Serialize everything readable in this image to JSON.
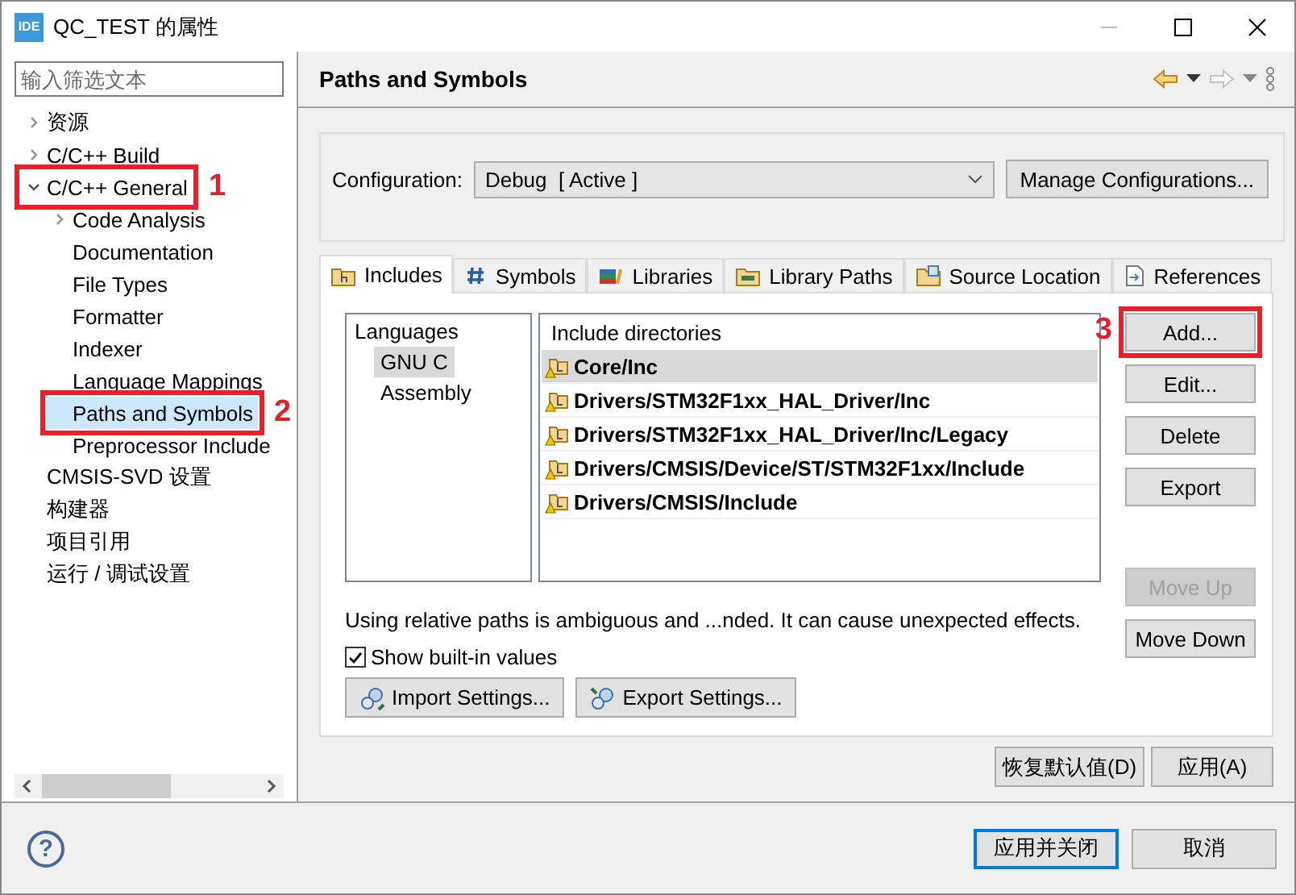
{
  "window": {
    "icon_label": "IDE",
    "title": "QC_TEST 的属性"
  },
  "sidebar": {
    "filter": {
      "placeholder": "输入筛选文本"
    },
    "tree": [
      {
        "label": "资源",
        "expanded": false,
        "selected": false
      },
      {
        "label": "C/C++ Build",
        "expanded": false,
        "selected": false
      },
      {
        "label": "C/C++ General",
        "expanded": true,
        "selected": false,
        "callout": "1",
        "children": [
          {
            "label": "Code Analysis",
            "expanded": false,
            "selected": false
          },
          {
            "label": "Documentation",
            "selected": false
          },
          {
            "label": "File Types",
            "selected": false
          },
          {
            "label": "Formatter",
            "selected": false
          },
          {
            "label": "Indexer",
            "selected": false
          },
          {
            "label": "Language Mappings",
            "selected": false
          },
          {
            "label": "Paths and Symbols",
            "selected": true,
            "callout": "2"
          },
          {
            "label": "Preprocessor Include",
            "selected": false
          }
        ]
      },
      {
        "label": "CMSIS-SVD 设置",
        "selected": false
      },
      {
        "label": "构建器",
        "selected": false
      },
      {
        "label": "项目引用",
        "selected": false
      },
      {
        "label": "运行 / 调试设置",
        "selected": false
      }
    ]
  },
  "page": {
    "title": "Paths and Symbols",
    "configuration": {
      "label": "Configuration:",
      "value": "Debug  [ Active ]",
      "manage_button": "Manage Configurations..."
    },
    "tabs": [
      {
        "label": "Includes",
        "kind": "includes",
        "selected": true
      },
      {
        "label": "Symbols",
        "kind": "symbols",
        "selected": false
      },
      {
        "label": "Libraries",
        "kind": "libraries",
        "selected": false
      },
      {
        "label": "Library Paths",
        "kind": "library-paths",
        "selected": false
      },
      {
        "label": "Source Location",
        "kind": "source-location",
        "selected": false
      },
      {
        "label": "References",
        "kind": "references",
        "selected": false
      }
    ],
    "languages": {
      "header": "Languages",
      "items": [
        {
          "label": "GNU C",
          "selected": true
        },
        {
          "label": "Assembly",
          "selected": false
        }
      ]
    },
    "include_directories": {
      "header": "Include directories",
      "rows": [
        {
          "path": "Core/Inc",
          "selected": true
        },
        {
          "path": "Drivers/STM32F1xx_HAL_Driver/Inc",
          "selected": false
        },
        {
          "path": "Drivers/STM32F1xx_HAL_Driver/Inc/Legacy",
          "selected": false
        },
        {
          "path": "Drivers/CMSIS/Device/ST/STM32F1xx/Include",
          "selected": false
        },
        {
          "path": "Drivers/CMSIS/Include",
          "selected": false
        }
      ]
    },
    "buttons": [
      {
        "label": "Add...",
        "disabled": false,
        "callout": "3"
      },
      {
        "label": "Edit...",
        "disabled": false
      },
      {
        "label": "Delete",
        "disabled": false
      },
      {
        "label": "Export",
        "disabled": false
      }
    ],
    "move_buttons": [
      {
        "label": "Move Up",
        "disabled": true
      },
      {
        "label": "Move Down",
        "disabled": false
      }
    ],
    "note": "Using relative paths is ambiguous and ...nded. It can cause unexpected effects.",
    "show_built_in": {
      "label": "Show built-in values",
      "checked": true
    },
    "settings_buttons": [
      {
        "label": "Import Settings...",
        "kind": "import"
      },
      {
        "label": "Export Settings...",
        "kind": "export"
      }
    ],
    "restore_button": "恢复默认值(D)",
    "apply_button": "应用(A)"
  },
  "footer": {
    "help": "?",
    "apply_close_button": "应用并关闭",
    "cancel_button": "取消"
  }
}
